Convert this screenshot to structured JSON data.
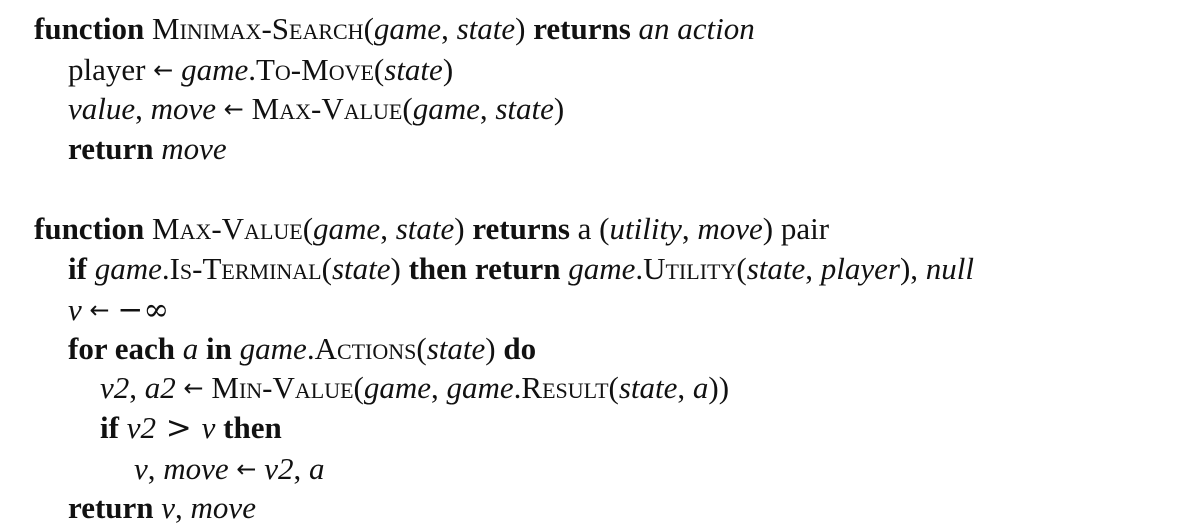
{
  "minimax_search": {
    "header": {
      "kw_function": "function",
      "name": "Minimax-Search",
      "open_paren": "(",
      "arg_game": "game",
      "comma1": ", ",
      "arg_state": "state",
      "close_paren": ")",
      "kw_returns": "returns",
      "return_desc": "an action"
    },
    "line1": {
      "var": "player",
      "arrow": "←",
      "obj": "game",
      "dot": ".",
      "fn": "To-Move",
      "open": "(",
      "arg": "state",
      "close": ")"
    },
    "line2": {
      "var1": "value",
      "comma": ", ",
      "var2": "move",
      "arrow": "←",
      "fn": "Max-Value",
      "open": "(",
      "arg1": "game",
      "comma2": ", ",
      "arg2": "state",
      "close": ")"
    },
    "line3": {
      "kw_return": "return",
      "var": "move"
    }
  },
  "max_value": {
    "header": {
      "kw_function": "function",
      "name": "Max-Value",
      "open_paren": "(",
      "arg_game": "game",
      "comma1": ", ",
      "arg_state": "state",
      "close_paren": ")",
      "kw_returns": "returns",
      "text_a": "a (",
      "ret_utility": "utility",
      "comma2": ", ",
      "ret_move": "move",
      "text_pair": ") pair"
    },
    "line1": {
      "kw_if": "if",
      "obj": "game",
      "dot": ".",
      "fn": "Is-Terminal",
      "open": "(",
      "arg": "state",
      "close": ")",
      "kw_then_return": "then return",
      "obj2": "game",
      "dot2": ".",
      "fn2": "Utility",
      "open2": "(",
      "arg2a": "state",
      "comma": ", ",
      "arg2b": "player",
      "close2": "),",
      "null": "null"
    },
    "line2": {
      "var": "v",
      "arrow": "←",
      "value": "−∞"
    },
    "line3": {
      "kw_for_each": "for each",
      "var": "a",
      "kw_in": "in",
      "obj": "game",
      "dot": ".",
      "fn": "Actions",
      "open": "(",
      "arg": "state",
      "close": ")",
      "kw_do": "do"
    },
    "line4": {
      "var1": "v2",
      "comma": ", ",
      "var2": "a2",
      "arrow": "←",
      "fn": "Min-Value",
      "open": "(",
      "arg1": "game",
      "comma2": ", ",
      "obj": "game",
      "dot": ".",
      "fn2": "Result",
      "open2": "(",
      "arg2a": "state",
      "comma3": ", ",
      "arg2b": "a",
      "close": "))"
    },
    "line5": {
      "kw_if": "if",
      "var1": "v2",
      "op": " > ",
      "var2": "v",
      "kw_then": "then"
    },
    "line6": {
      "var1": "v",
      "comma": ", ",
      "var2": "move",
      "arrow": "←",
      "val1": "v2",
      "comma2": ", ",
      "val2": "a"
    },
    "line7": {
      "kw_return": "return",
      "var1": "v",
      "comma": ", ",
      "var2": "move"
    }
  }
}
